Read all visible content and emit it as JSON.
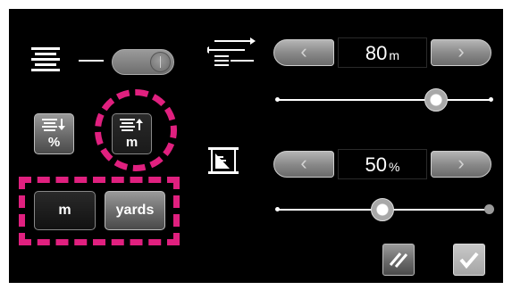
{
  "toggle": {
    "state": "on"
  },
  "unit_mode_buttons": [
    {
      "id": "percent",
      "label": "%"
    },
    {
      "id": "meters",
      "label": "m"
    }
  ],
  "unit_buttons": [
    {
      "id": "m",
      "label": "m"
    },
    {
      "id": "yards",
      "label": "yards"
    }
  ],
  "distance": {
    "value": "80",
    "unit": "m",
    "slider_fraction": 0.74
  },
  "percentage": {
    "value": "50",
    "unit": "%",
    "slider_fraction": 0.5
  },
  "icons": {
    "align": "align-lines-icon",
    "distance": "distance-lines-icon",
    "percent_frame": "percent-frame-icon",
    "reset": "reset-slash-icon",
    "confirm": "checkmark-icon"
  },
  "colors": {
    "highlight": "#e0207f",
    "background": "#000000"
  }
}
